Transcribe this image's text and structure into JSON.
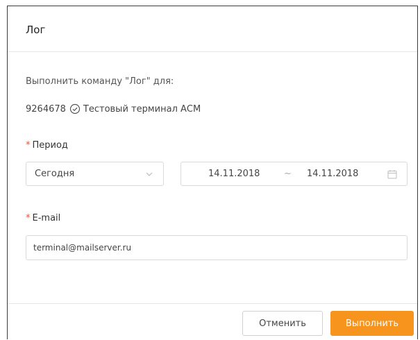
{
  "dialog": {
    "title": "Лог",
    "intro": "Выполнить команду \"Лог\" для:",
    "terminal": {
      "id": "9264678",
      "name": "Тестовый терминал АСМ",
      "icon": "check-circle-icon"
    },
    "period": {
      "required_mark": "*",
      "label": "Период",
      "preset": "Сегодня",
      "start_date": "14.11.2018",
      "separator": "~",
      "end_date": "14.11.2018"
    },
    "email": {
      "required_mark": "*",
      "label": "E-mail",
      "value": "terminal@mailserver.ru"
    },
    "buttons": {
      "cancel": "Отменить",
      "run": "Выполнить"
    }
  },
  "colors": {
    "accent": "#f7941d",
    "required": "#e5533d",
    "border": "#d9d9d9"
  }
}
